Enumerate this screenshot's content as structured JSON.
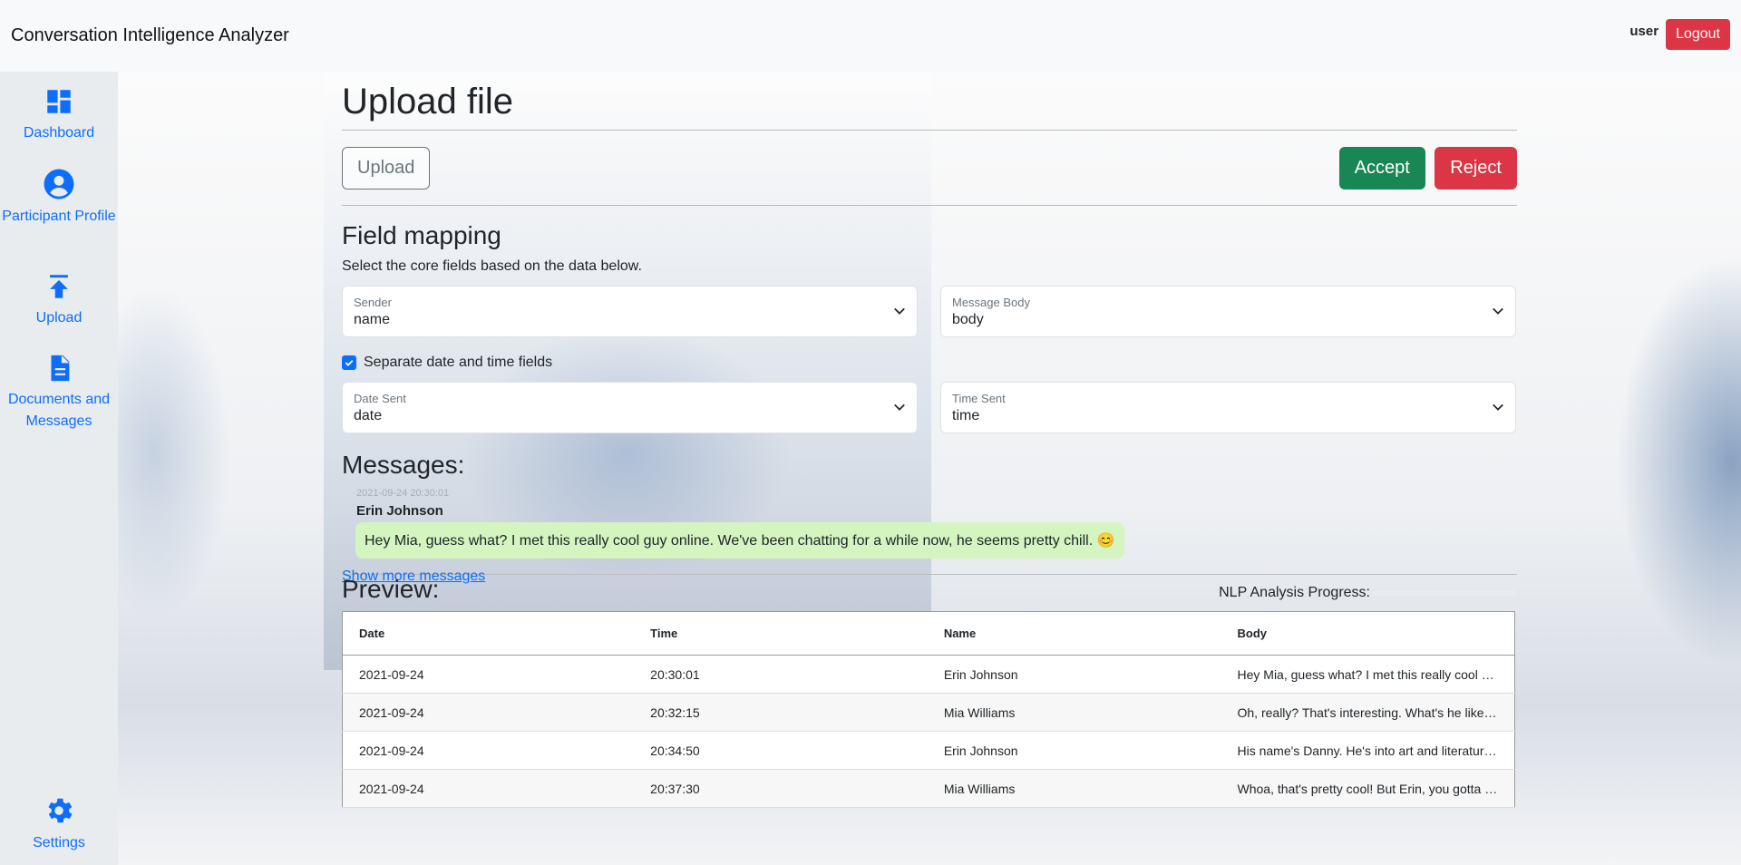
{
  "app": {
    "title": "Conversation Intelligence Analyzer"
  },
  "header": {
    "user": "user",
    "logout_label": "Logout"
  },
  "sidebar": {
    "items": [
      {
        "label": "Dashboard",
        "icon": "dashboard-icon"
      },
      {
        "label": "Participant Profile",
        "icon": "person-icon"
      },
      {
        "label": "Upload",
        "icon": "upload-icon"
      },
      {
        "label": "Documents and Messages",
        "icon": "document-icon"
      }
    ],
    "settings": {
      "label": "Settings",
      "icon": "gear-icon"
    }
  },
  "page": {
    "title": "Upload file",
    "upload_label": "Upload",
    "accept_label": "Accept",
    "reject_label": "Reject"
  },
  "field_mapping": {
    "title": "Field mapping",
    "help": "Select the core fields based on the data below.",
    "sender": {
      "label": "Sender",
      "value": "name"
    },
    "message_body": {
      "label": "Message Body",
      "value": "body"
    },
    "separate_label": "Separate date and time fields",
    "separate_checked": true,
    "date_sent": {
      "label": "Date Sent",
      "value": "date"
    },
    "time_sent": {
      "label": "Time Sent",
      "value": "time"
    }
  },
  "messages": {
    "title": "Messages:",
    "timestamp": "2021-09-24 20:30:01",
    "sender": "Erin Johnson",
    "body": "Hey Mia, guess what? I met this really cool guy online. We've been chatting for a while now, he seems pretty chill. 😊",
    "show_more": "Show more messages"
  },
  "preview": {
    "title": "Preview:",
    "progress_label": "NLP Analysis Progress:",
    "progress_value": 0,
    "columns": [
      "Date",
      "Time",
      "Name",
      "Body"
    ],
    "rows": [
      [
        "2021-09-24",
        "20:30:01",
        "Erin Johnson",
        "Hey Mia, guess what? I met this really cool g..."
      ],
      [
        "2021-09-24",
        "20:32:15",
        "Mia Williams",
        "Oh, really? That's interesting. What's he like? ..."
      ],
      [
        "2021-09-24",
        "20:34:50",
        "Erin Johnson",
        "His name's Danny. He's into art and literature..."
      ],
      [
        "2021-09-24",
        "20:37:30",
        "Mia Williams",
        "Whoa, that's pretty cool! But Erin, you gotta b..."
      ]
    ]
  },
  "colors": {
    "primary": "#0d6efd",
    "success": "#198754",
    "danger": "#dc3545",
    "bubble": "#d4f5c0"
  }
}
